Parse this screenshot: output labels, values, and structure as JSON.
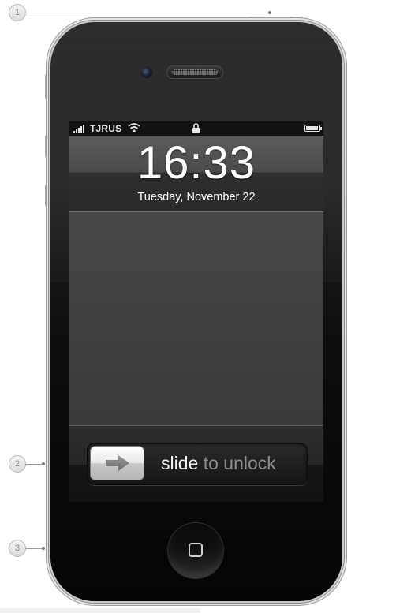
{
  "callouts": [
    "1",
    "2",
    "3"
  ],
  "status_bar": {
    "carrier": "TJRUS",
    "signal_bars": 5,
    "battery_level": 0.9
  },
  "lock_screen": {
    "time": "16:33",
    "date": "Tuesday, November 22"
  },
  "slider": {
    "highlight": "slide",
    "rest": " to unlock"
  },
  "icons": [
    "signal-bars-icon",
    "wifi-icon",
    "padlock-icon",
    "battery-icon",
    "arrow-right-icon",
    "home-square-icon"
  ],
  "colors": {
    "screen_bg": "#3d3d3d",
    "status_bg": "#121212",
    "text": "#ffffff",
    "slider_dim_text": "#8d8d8d"
  }
}
